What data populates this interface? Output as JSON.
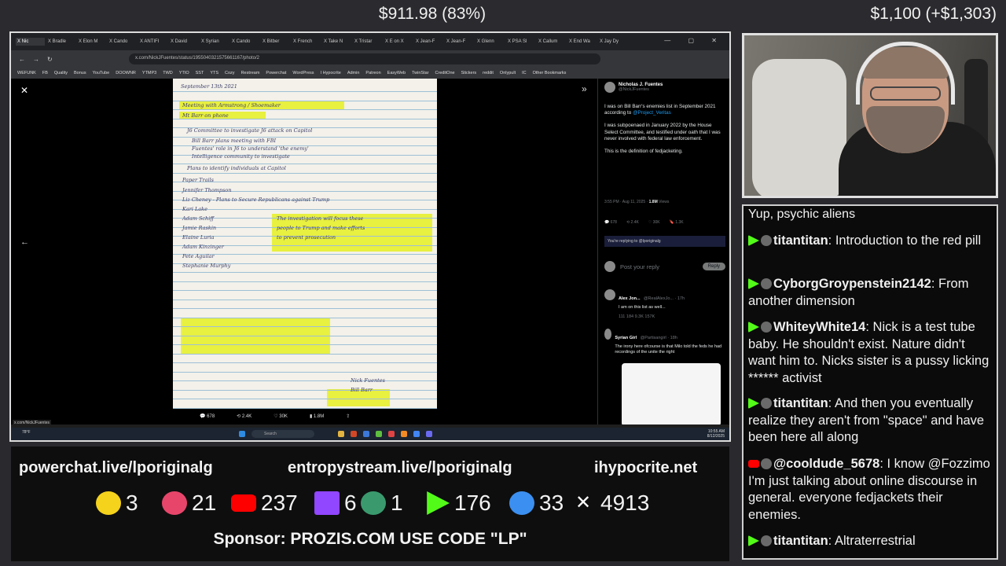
{
  "top": {
    "center_value": "$911.98 (83%)",
    "right_value": "$1,100 (+$1,303)"
  },
  "browser": {
    "tabs": [
      "X Nic",
      "X Bradle",
      "X Elon M",
      "X Cando",
      "X ANTIFI",
      "X David",
      "X Syrian",
      "X Cando",
      "X Bitber",
      "X French",
      "X Take N",
      "X Tristar",
      "X E on X",
      "X Jean-F",
      "X Jean-F",
      "X Glenn",
      "X PSA Sl",
      "X Callum",
      "X End Wa",
      "X Jay Dy"
    ],
    "window_controls": "— ▢ ✕",
    "url": "x.com/NickJFuentes/status/1955040321575661167/photo/2",
    "bookmarks": [
      "WEFUNK",
      "FB",
      "Quality",
      "Bonus",
      "YouTube",
      "DOOWNR",
      "YTMP3",
      "TWD",
      "YTIO",
      "SST",
      "YTS",
      "Cozy",
      "Restream",
      "Powerchat",
      "WordPress",
      "I Hypocrite",
      "Admin",
      "Patreon",
      "EasyWeb",
      "TwinStar",
      "CreditOne",
      "Stickers",
      "reddit",
      "Onlypult",
      "IC",
      "Other Bookmarks"
    ],
    "photo_lines": [
      "September 13th 2021",
      "Meeting with Armstrong / Shoemaker",
      "Mt Barr on phone",
      "J6 Committee to investigate J6 attack on Capitol",
      "Bill Barr plans meeting with FBI",
      "Fuentes' role in J6 to understand 'the enemy'",
      "Intelligence community to investigate",
      "Plans to identify individuals at Capitol",
      "Paper Trails",
      "Jennifer Thompson",
      "Liz Cheney - Plans to Secure Republicans against Trump",
      "Kari Lake",
      "Adam Schiff",
      "Jamie Raskin",
      "Elaine Luria",
      "Adam Kinzinger",
      "Pete Aguilar",
      "Stephanie Murphy",
      "The investigation will focus these",
      "people to Trump and make efforts",
      "to prevent prosecution",
      "Nick Fuentes",
      "Bill Barr"
    ],
    "image_actions": {
      "replies": "678",
      "reposts": "2.4K",
      "likes": "30K",
      "views": "1.8M"
    },
    "tweet": {
      "author": "Nicholas J. Fuentes",
      "handle": "@NickJFuentes",
      "para1_a": "I was on Bill Barr's enemies list in September 2021 according to",
      "para1_link": "@Project_Veritas",
      "para2": "I was subpoenaed in January 2022 by the House Select Committee, and testified under oath that I was never involved with federal law enforcement.",
      "para3": "This is the definition of fedjacketing.",
      "meta_time": "3:55 PM · Aug 11, 2025 ·",
      "meta_views": "1.8M",
      "meta_views_label": "Views",
      "stats": [
        "678",
        "2.4K",
        "30K",
        "1.3K"
      ],
      "replying_to": "You're replying to @lporiginalg",
      "reply_placeholder": "Post your reply",
      "reply_button": "Reply"
    },
    "replies": [
      {
        "name": "Alex Jon...",
        "handle": "@RealAlexJo... · 17h",
        "text": "I am on this list as well...",
        "stats": "111  184  9.3K  157K"
      },
      {
        "name": "Syrian Girl",
        "handle": "@Partisangirl · 18h",
        "text": "The irony here ofcourse is that Milo told the feds he had recordings of the unite the right"
      }
    ],
    "status_link": "x.com/NickJFuentes",
    "taskbar": {
      "search": "Search",
      "weather": "78°F",
      "time": "10:55 AM",
      "date": "8/12/2025"
    }
  },
  "bottom": {
    "links": [
      "powerchat.live/lporiginalg",
      "entropystream.live/lporiginalg",
      "ihypocrite.net"
    ],
    "counts": [
      {
        "platform": "rumble-icon",
        "value": "3",
        "color": "#f5d21c"
      },
      {
        "platform": "kick-alt-icon",
        "value": "21",
        "color": "#e8456b"
      },
      {
        "platform": "youtube-icon",
        "value": "237",
        "color": "#ff0000"
      },
      {
        "platform": "twitch-icon",
        "value": "6",
        "color": "#9146ff"
      },
      {
        "platform": "orb-icon",
        "value": "1",
        "color": "#3a9a6e"
      },
      {
        "platform": "kick-icon",
        "value": "176",
        "color": "#53fc18"
      },
      {
        "platform": "moon-icon",
        "value": "33",
        "color": "#3b8ff0"
      },
      {
        "platform": "x-icon",
        "value": "4913",
        "color": "#ffffff"
      }
    ],
    "sponsor": "Sponsor: PROZIS.COM USE CODE \"LP\""
  },
  "chat": {
    "top_line": "Yup, psychic aliens",
    "messages": [
      {
        "platform": "kick",
        "user": "titantitan",
        "user_color": "#f0f0f0",
        "text": "Introduction to the red pill"
      },
      {
        "platform": "kick",
        "user": "CyborgGroypenstein2142",
        "user_color": "#f0f0f0",
        "text": "From another dimension"
      },
      {
        "platform": "kick",
        "user": "WhiteyWhite14",
        "user_color": "#f0f0f0",
        "text": "Nick is a test tube baby. He shouldn't exist. Nature didn't want him to. Nicks sister is a pussy licking ****** activist"
      },
      {
        "platform": "kick",
        "user": "titantitan",
        "user_color": "#f0f0f0",
        "text": "And then you eventually realize they aren't from \"space\" and have been here all along"
      },
      {
        "platform": "youtube",
        "user": "@cooldude_5678",
        "user_color": "#f0f0f0",
        "text": "I know @Fozzimo I'm just talking about online discourse in general. everyone fedjackets their enemies."
      },
      {
        "platform": "kick",
        "user": "titantitan",
        "user_color": "#f0f0f0",
        "text": "Altraterrestrial"
      }
    ]
  }
}
